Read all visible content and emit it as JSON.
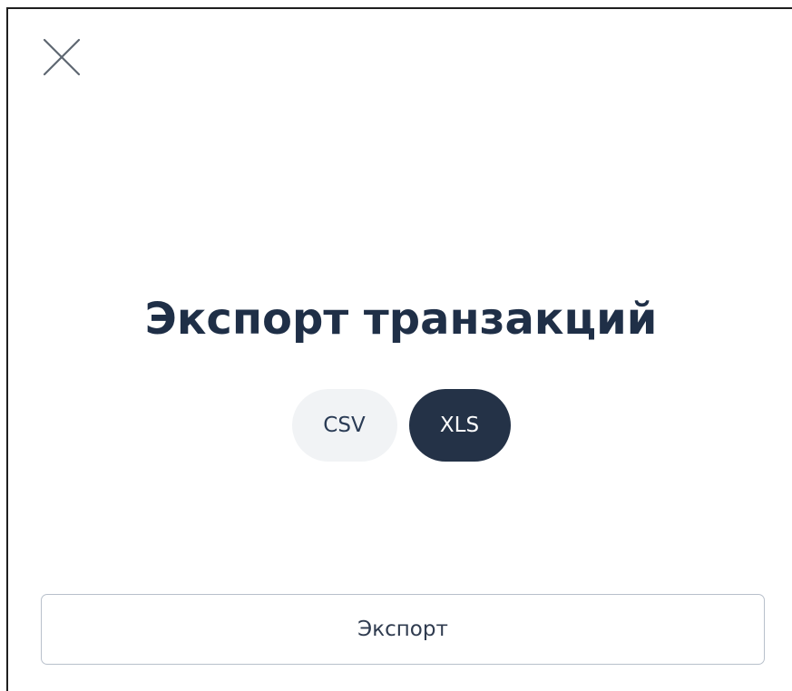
{
  "dialog": {
    "title": "Экспорт транзакций",
    "close_icon": "close-icon"
  },
  "formats": {
    "options": [
      "CSV",
      "XLS"
    ],
    "selected": "XLS"
  },
  "actions": {
    "export_label": "Экспорт"
  },
  "colors": {
    "title": "#1f2f47",
    "selected_chip_bg": "#243247",
    "unselected_chip_bg": "#f1f3f5",
    "button_border": "#b8c0cb"
  }
}
